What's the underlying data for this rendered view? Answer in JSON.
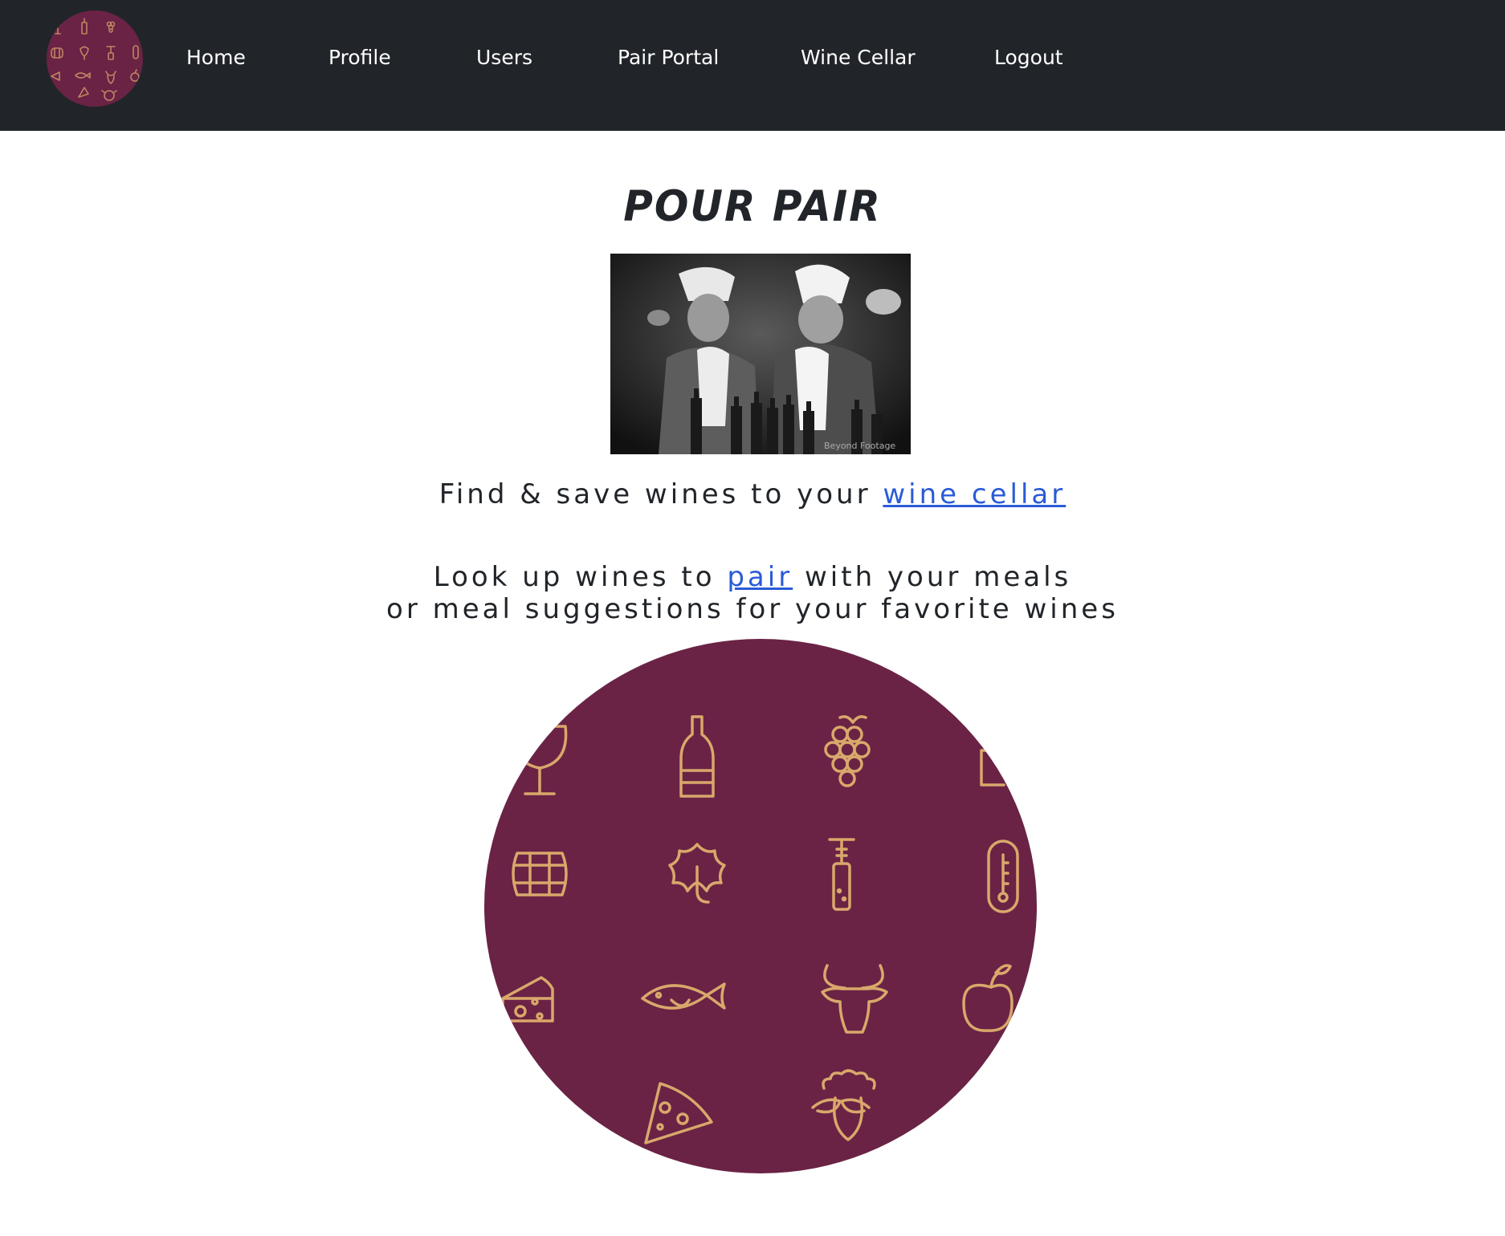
{
  "colors": {
    "nav_bg": "#212529",
    "logo_bg": "#6a2345",
    "logo_icon": "#d9a86b",
    "link": "#2a5bd7"
  },
  "nav": {
    "logo_icon": "wine-food-pattern-logo",
    "items": [
      {
        "label": "Home"
      },
      {
        "label": "Profile"
      },
      {
        "label": "Users"
      },
      {
        "label": "Pair Portal"
      },
      {
        "label": "Wine Cellar"
      },
      {
        "label": "Logout"
      }
    ]
  },
  "main": {
    "title": "POUR PAIR",
    "cellar_line": {
      "text_before": "Find & save wines to your ",
      "link_text": "wine cellar"
    },
    "pair_line": {
      "text_before": "Look up wines to ",
      "link_text": "pair",
      "text_after": " with your meals",
      "second_line": "or meal suggestions for your favorite wines"
    },
    "logo_icons": [
      "wine-glass-icon",
      "wine-bottle-icon",
      "grapes-icon",
      "barrel-icon",
      "grape-leaf-icon",
      "corkscrew-icon",
      "thermometer-icon",
      "cheese-icon",
      "fish-icon",
      "bull-icon",
      "apple-icon",
      "pizza-icon",
      "sheep-icon"
    ]
  }
}
